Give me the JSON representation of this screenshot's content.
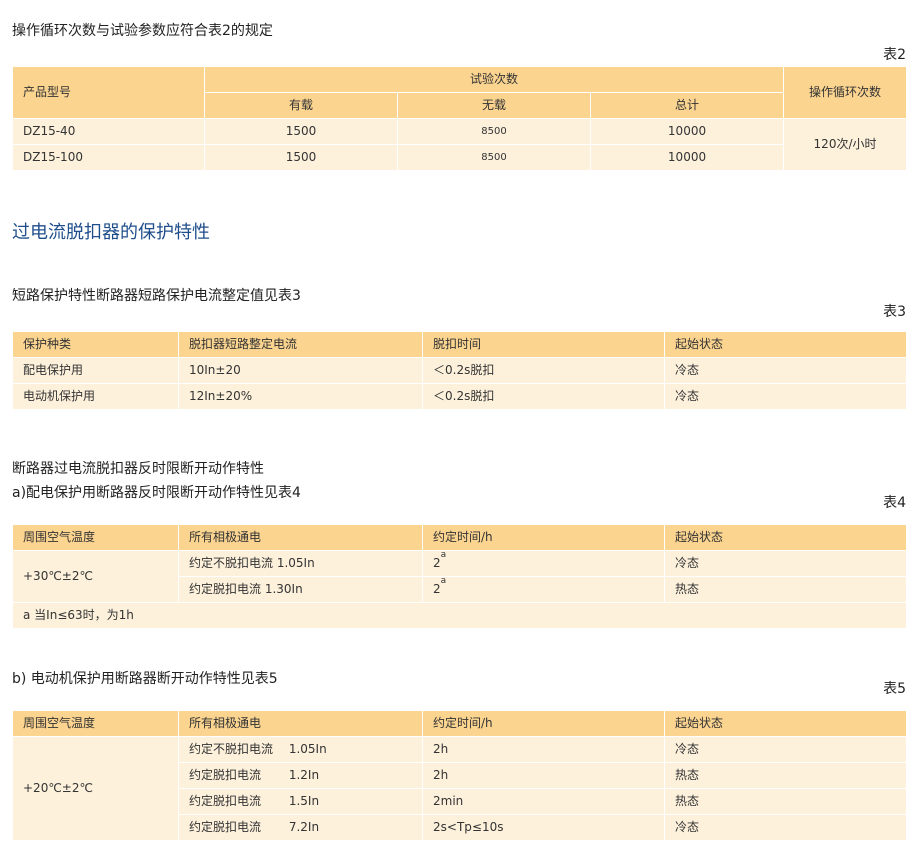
{
  "intro": "操作循环次数与试验参数应符合表2的规定",
  "table2": {
    "label": "表2",
    "head_model": "产品型号",
    "head_tests": "试验次数",
    "head_cycles": "操作循环次数",
    "sub_load": "有载",
    "sub_noload": "无载",
    "sub_total": "总计",
    "rows": [
      {
        "model": "DZ15-40",
        "load": "1500",
        "noload": "8500",
        "total": "10000"
      },
      {
        "model": "DZ15-100",
        "load": "1500",
        "noload": "8500",
        "total": "10000"
      }
    ],
    "cycles": "120次/小时"
  },
  "section_title": "过电流脱扣器的保护特性",
  "table3_caption": "短路保护特性断路器短路保护电流整定值见表3",
  "table3": {
    "label": "表3",
    "headers": [
      "保护种类",
      "脱扣器短路整定电流",
      "脱扣时间",
      "起始状态"
    ],
    "rows": [
      [
        "配电保护用",
        "10In±20",
        "＜0.2s脱扣",
        "冷态"
      ],
      [
        "电动机保护用",
        "12In±20%",
        "＜0.2s脱扣",
        "冷态"
      ]
    ]
  },
  "inverse_title": "断路器过电流脱扣器反时限断开动作特性",
  "table4_caption": "a)配电保护用断路器反时限断开动作特性见表4",
  "table4": {
    "label": "表4",
    "headers": [
      "周围空气温度",
      "所有相极通电",
      "约定时间/h",
      "起始状态"
    ],
    "temp": "+30℃±2℃",
    "rows": [
      {
        "current": "约定不脱扣电流 1.05In",
        "time": "2",
        "sup": "a",
        "state": "冷态"
      },
      {
        "current": "约定脱扣电流 1.30In",
        "time": "2",
        "sup": "a",
        "state": "热态"
      }
    ],
    "note": "a 当In≤63时，为1h"
  },
  "table5_caption": "b) 电动机保护用断路器断开动作特性见表5",
  "table5": {
    "label": "表5",
    "headers": [
      "周围空气温度",
      "所有相极通电",
      "约定时间/h",
      "起始状态"
    ],
    "temp": "+20℃±2℃",
    "rows": [
      {
        "current": "约定不脱扣电流　 1.05In",
        "time": "2h",
        "state": "冷态"
      },
      {
        "current": "约定脱扣电流　　 1.2In",
        "time": "2h",
        "state": "热态"
      },
      {
        "current": "约定脱扣电流　　 1.5In",
        "time": "2min",
        "state": "热态"
      },
      {
        "current": "约定脱扣电流　　 7.2In",
        "time": "2s<Tp≤10s",
        "state": "冷态"
      }
    ]
  },
  "colors": {
    "header_bg": "#fbd490",
    "body_bg": "#fdf1dc",
    "heading": "#1f4e8c"
  }
}
